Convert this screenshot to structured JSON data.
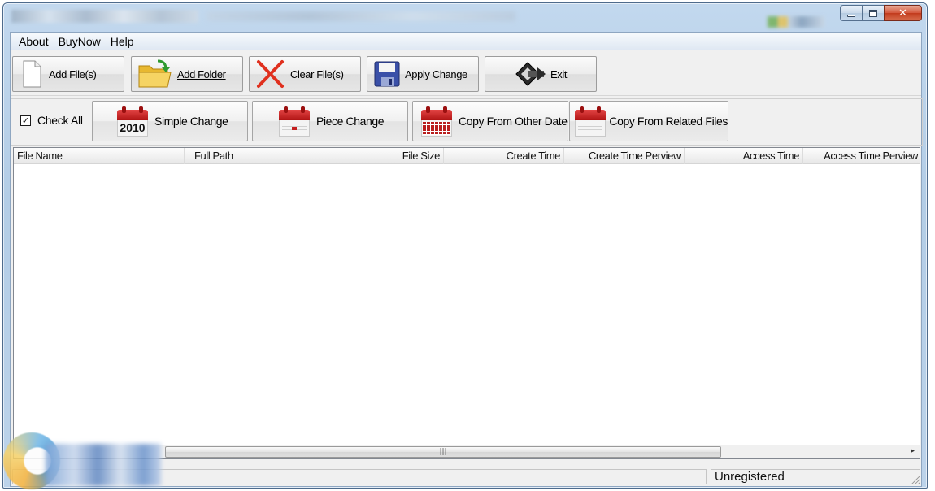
{
  "menu": {
    "about": "About",
    "buynow": "BuyNow",
    "help": "Help"
  },
  "toolbar": {
    "add_files": "Add File(s)",
    "add_folder": "Add Folder",
    "clear_files": "Clear File(s)",
    "apply_change": "Apply Change",
    "exit": "Exit"
  },
  "toolbar2": {
    "check_all": "Check All",
    "simple_change": "Simple Change",
    "simple_change_year": "2010",
    "piece_change": "Piece Change",
    "copy_other_date": "Copy From Other Date",
    "copy_related_files": "Copy From Related Files"
  },
  "columns": [
    "File Name",
    "Full Path",
    "File Size",
    "Create Time",
    "Create Time Perview",
    "Access Time",
    "Access Time Perview"
  ],
  "status": {
    "registration": "Unregistered"
  },
  "colors": {
    "window_frame": "#b3cde6",
    "close_button": "#c23a1c",
    "calendar_red": "#b01414"
  }
}
